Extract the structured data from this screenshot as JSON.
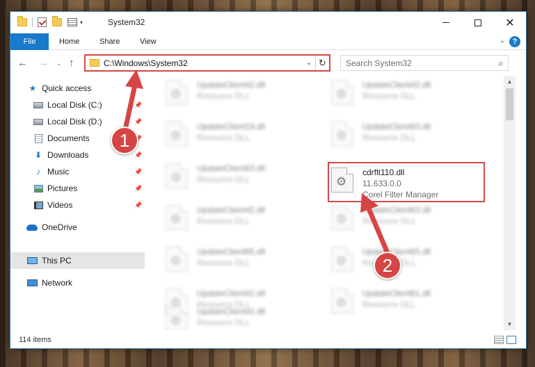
{
  "window": {
    "title": "System32",
    "qat_dropdown": "▾"
  },
  "ribbon": {
    "tabs": [
      {
        "label": "File"
      },
      {
        "label": "Home"
      },
      {
        "label": "Share"
      },
      {
        "label": "View"
      }
    ],
    "expand_chevron": "⌄",
    "help": "?"
  },
  "nav": {
    "address": "C:\\Windows\\System32",
    "search_placeholder": "Search System32"
  },
  "sidebar": {
    "items": [
      {
        "label": "Quick access",
        "icon": "star-icon"
      },
      {
        "label": "Local Disk (C:)",
        "icon": "disk-icon",
        "pinned": true
      },
      {
        "label": "Local Disk (D:)",
        "icon": "disk-icon",
        "pinned": true
      },
      {
        "label": "Documents",
        "icon": "documents-icon",
        "pinned": true
      },
      {
        "label": "Downloads",
        "icon": "downloads-icon",
        "pinned": true
      },
      {
        "label": "Music",
        "icon": "music-icon",
        "pinned": true
      },
      {
        "label": "Pictures",
        "icon": "pictures-icon",
        "pinned": true
      },
      {
        "label": "Videos",
        "icon": "videos-icon",
        "pinned": true
      },
      {
        "label": "OneDrive",
        "icon": "onedrive-icon"
      },
      {
        "label": "This PC",
        "icon": "this-pc-icon",
        "selected": true
      },
      {
        "label": "Network",
        "icon": "network-icon"
      }
    ]
  },
  "files": {
    "left_column": [
      {
        "name": "UpdateClient42.dll",
        "type": "Resource DLL"
      },
      {
        "name": "UpdateClient19.dll",
        "type": "Resource DLL"
      },
      {
        "name": "UpdateClient63.dll",
        "type": "Resource DLL"
      },
      {
        "name": "UpdateClient42.dll",
        "type": "Resource DLL"
      },
      {
        "name": "UpdateClient65.dll",
        "type": "Resource DLL"
      },
      {
        "name": "UpdateClient42.dll",
        "type": "Resource DLL"
      },
      {
        "name": "UpdateClient42.dll",
        "type": "Resource DLL"
      }
    ],
    "right_column": [
      {
        "name": "UpdateClient42.dll",
        "type": "Resource DLL"
      },
      {
        "name": "UpdateClient63.dll",
        "type": "Resource DLL"
      },
      {
        "name": "UpdateClient63.dll",
        "type": "Resource DLL"
      },
      {
        "name": "UpdateClient65.dll",
        "type": "Resource DLL"
      },
      {
        "name": "UpdateClient61.dll",
        "type": "Resource DLL"
      }
    ],
    "highlighted": {
      "name": "cdrflt110.dll",
      "version": "11.633.0.0",
      "description": "Corel Filter Manager"
    }
  },
  "status": {
    "item_count": "114 items"
  },
  "annotations": {
    "step1": "1",
    "step2": "2",
    "color": "#d64545"
  }
}
